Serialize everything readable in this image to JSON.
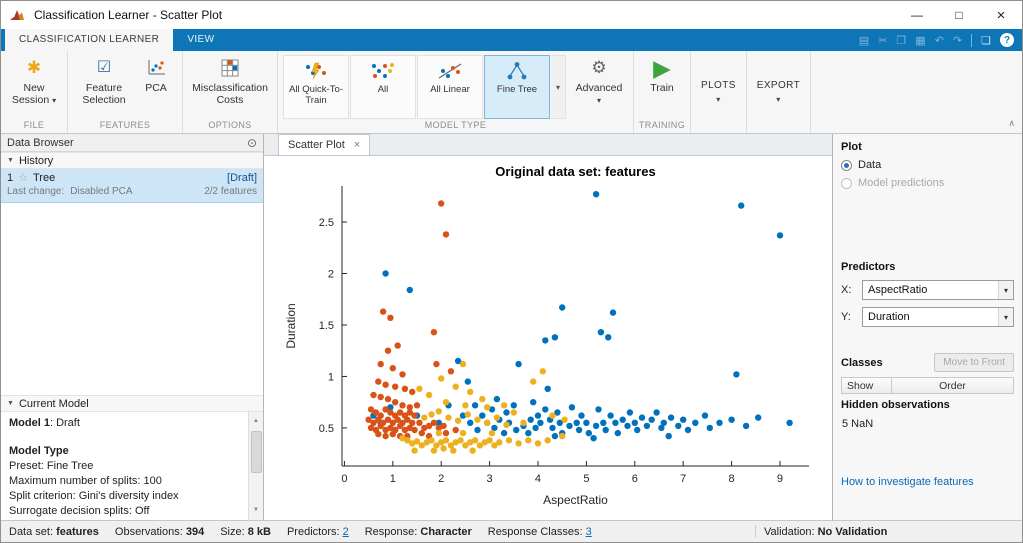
{
  "window": {
    "title": "Classification Learner - Scatter Plot"
  },
  "icons": {
    "save": "▤",
    "cut": "✂",
    "copy": "❐",
    "paste": "▦",
    "undo": "↶",
    "redo": "↷",
    "dock": "❏",
    "help": "?",
    "new_session": "✱",
    "feature_list": "☑",
    "gear": "⚙",
    "play": "▶",
    "caret": "▾",
    "collapse": "▼",
    "panel_menu": "⊙",
    "star": "☆",
    "close": "×",
    "min": "—",
    "max": "□",
    "ribbon_collapse": "∧",
    "scroll_up": "▲",
    "scroll_down": "▼"
  },
  "ribbon": {
    "tabs": [
      "CLASSIFICATION LEARNER",
      "VIEW"
    ],
    "file": {
      "label": "FILE",
      "new_session": "New Session"
    },
    "features": {
      "label": "FEATURES",
      "feature_selection": "Feature Selection",
      "pca": "PCA"
    },
    "options": {
      "label": "OPTIONS",
      "misclassification_costs": "Misclassification Costs"
    },
    "model_type": {
      "label": "MODEL TYPE",
      "gallery": [
        "All Quick-To-Train",
        "All",
        "All Linear",
        "Fine Tree"
      ],
      "selected": "Fine Tree",
      "advanced": "Advanced"
    },
    "training": {
      "label": "TRAINING",
      "train": "Train"
    },
    "plots_label": "PLOTS",
    "export_label": "EXPORT"
  },
  "data_browser": {
    "title": "Data Browser",
    "history": {
      "header": "History",
      "item": {
        "index": "1",
        "name": "Tree",
        "status": "[Draft]",
        "last_change_label": "Last change:",
        "last_change_value": "Disabled PCA",
        "features": "2/2 features"
      }
    },
    "current_model": {
      "header": "Current Model",
      "model_label": "Model 1",
      "model_status": ": Draft",
      "type_header": "Model Type",
      "preset": "Preset: Fine Tree",
      "max_splits": "Maximum number of splits: 100",
      "split_criterion": "Split criterion: Gini's diversity index",
      "surrogate": "Surrogate decision splits: Off"
    }
  },
  "document": {
    "tab": "Scatter Plot"
  },
  "right_panel": {
    "plot": {
      "header": "Plot",
      "data_option": "Data",
      "predictions_option": "Model predictions",
      "selected": "Data"
    },
    "predictors": {
      "header": "Predictors",
      "x_label": "X:",
      "x_value": "AspectRatio",
      "y_label": "Y:",
      "y_value": "Duration"
    },
    "classes": {
      "header": "Classes",
      "move_to_front": "Move to Front",
      "show_col": "Show",
      "order_col": "Order"
    },
    "hidden": {
      "header": "Hidden observations",
      "value": "5 NaN"
    },
    "link": "How to investigate features"
  },
  "status_bar": {
    "items": [
      {
        "label": "Data set:",
        "value": "features",
        "link": false
      },
      {
        "label": "Observations:",
        "value": "394",
        "link": false
      },
      {
        "label": "Size:",
        "value": "8 kB",
        "link": false
      },
      {
        "label": "Predictors:",
        "value": "2",
        "link": true
      },
      {
        "label": "Response:",
        "value": "Character",
        "link": false
      },
      {
        "label": "Response Classes:",
        "value": "3",
        "link": true
      }
    ],
    "validation_label": "Validation: ",
    "validation_value": "No Validation"
  },
  "chart_data": {
    "type": "scatter",
    "title": "Original data set: features",
    "xlabel": "AspectRatio",
    "ylabel": "Duration",
    "xlim": [
      -0.05,
      9.6
    ],
    "ylim": [
      0.13,
      2.85
    ],
    "xticks": [
      0,
      1,
      2,
      3,
      4,
      5,
      6,
      7,
      8,
      9
    ],
    "yticks": [
      0.5,
      1,
      1.5,
      2,
      2.5
    ],
    "grid": false,
    "legend": "none",
    "series": [
      {
        "name": "blue",
        "color": "#0072BD",
        "points": [
          [
            5.2,
            2.77
          ],
          [
            8.2,
            2.66
          ],
          [
            9.0,
            2.37
          ],
          [
            0.85,
            2.0
          ],
          [
            1.35,
            1.84
          ],
          [
            4.5,
            1.67
          ],
          [
            5.55,
            1.62
          ],
          [
            5.3,
            1.43
          ],
          [
            4.35,
            1.38
          ],
          [
            5.45,
            1.38
          ],
          [
            4.15,
            1.35
          ],
          [
            3.6,
            1.12
          ],
          [
            2.35,
            1.15
          ],
          [
            8.1,
            1.02
          ],
          [
            2.55,
            0.95
          ],
          [
            4.2,
            0.88
          ],
          [
            2.7,
            0.72
          ],
          [
            3.15,
            0.78
          ],
          [
            3.9,
            0.75
          ],
          [
            4.7,
            0.7
          ],
          [
            5.25,
            0.68
          ],
          [
            4.15,
            0.68
          ],
          [
            3.35,
            0.65
          ],
          [
            4.4,
            0.65
          ],
          [
            5.9,
            0.65
          ],
          [
            6.45,
            0.65
          ],
          [
            2.45,
            0.62
          ],
          [
            2.85,
            0.62
          ],
          [
            4.0,
            0.62
          ],
          [
            4.9,
            0.62
          ],
          [
            5.5,
            0.62
          ],
          [
            7.45,
            0.62
          ],
          [
            0.6,
            0.62
          ],
          [
            3.2,
            0.58
          ],
          [
            3.85,
            0.58
          ],
          [
            4.25,
            0.58
          ],
          [
            5.75,
            0.58
          ],
          [
            6.35,
            0.58
          ],
          [
            8.0,
            0.58
          ],
          [
            2.6,
            0.55
          ],
          [
            2.95,
            0.55
          ],
          [
            3.4,
            0.55
          ],
          [
            4.05,
            0.55
          ],
          [
            4.45,
            0.55
          ],
          [
            4.8,
            0.55
          ],
          [
            5.0,
            0.55
          ],
          [
            5.35,
            0.55
          ],
          [
            5.6,
            0.55
          ],
          [
            6.0,
            0.55
          ],
          [
            6.6,
            0.55
          ],
          [
            7.25,
            0.55
          ],
          [
            7.75,
            0.55
          ],
          [
            9.2,
            0.55
          ],
          [
            0.75,
            0.55
          ],
          [
            1.95,
            0.55
          ],
          [
            3.7,
            0.52
          ],
          [
            4.65,
            0.52
          ],
          [
            5.2,
            0.52
          ],
          [
            5.85,
            0.52
          ],
          [
            6.25,
            0.52
          ],
          [
            6.9,
            0.52
          ],
          [
            8.3,
            0.52
          ],
          [
            3.1,
            0.5
          ],
          [
            3.95,
            0.5
          ],
          [
            4.3,
            0.5
          ],
          [
            6.55,
            0.5
          ],
          [
            7.55,
            0.5
          ],
          [
            2.75,
            0.48
          ],
          [
            3.55,
            0.48
          ],
          [
            4.85,
            0.48
          ],
          [
            5.4,
            0.48
          ],
          [
            6.05,
            0.48
          ],
          [
            7.1,
            0.48
          ],
          [
            1.05,
            0.48
          ],
          [
            3.3,
            0.45
          ],
          [
            3.8,
            0.45
          ],
          [
            4.5,
            0.45
          ],
          [
            5.05,
            0.45
          ],
          [
            5.65,
            0.45
          ],
          [
            4.35,
            0.42
          ],
          [
            6.7,
            0.42
          ],
          [
            5.15,
            0.4
          ],
          [
            1.5,
            0.62
          ],
          [
            2.15,
            0.72
          ],
          [
            0.95,
            0.7
          ],
          [
            8.55,
            0.6
          ],
          [
            6.15,
            0.6
          ],
          [
            7.0,
            0.58
          ],
          [
            6.75,
            0.6
          ],
          [
            3.5,
            0.72
          ],
          [
            3.05,
            0.68
          ]
        ]
      },
      {
        "name": "orange",
        "color": "#D95319",
        "points": [
          [
            2.0,
            2.68
          ],
          [
            2.1,
            2.38
          ],
          [
            0.8,
            1.63
          ],
          [
            0.95,
            1.57
          ],
          [
            1.85,
            1.43
          ],
          [
            1.1,
            1.3
          ],
          [
            0.9,
            1.25
          ],
          [
            0.75,
            1.12
          ],
          [
            1.9,
            1.12
          ],
          [
            1.0,
            1.08
          ],
          [
            2.2,
            1.05
          ],
          [
            1.2,
            1.02
          ],
          [
            0.7,
            0.95
          ],
          [
            0.85,
            0.92
          ],
          [
            1.05,
            0.9
          ],
          [
            1.25,
            0.88
          ],
          [
            1.4,
            0.85
          ],
          [
            0.6,
            0.82
          ],
          [
            0.75,
            0.8
          ],
          [
            0.9,
            0.78
          ],
          [
            1.05,
            0.75
          ],
          [
            1.2,
            0.72
          ],
          [
            1.5,
            0.72
          ],
          [
            1.35,
            0.7
          ],
          [
            0.55,
            0.68
          ],
          [
            0.65,
            0.65
          ],
          [
            0.85,
            0.68
          ],
          [
            0.95,
            0.65
          ],
          [
            1.15,
            0.65
          ],
          [
            1.35,
            0.65
          ],
          [
            0.75,
            0.62
          ],
          [
            1.05,
            0.62
          ],
          [
            1.25,
            0.62
          ],
          [
            1.45,
            0.62
          ],
          [
            0.5,
            0.58
          ],
          [
            0.7,
            0.58
          ],
          [
            0.9,
            0.58
          ],
          [
            1.1,
            0.58
          ],
          [
            1.3,
            0.58
          ],
          [
            0.6,
            0.55
          ],
          [
            0.8,
            0.55
          ],
          [
            1.0,
            0.55
          ],
          [
            1.2,
            0.55
          ],
          [
            1.4,
            0.55
          ],
          [
            1.55,
            0.55
          ],
          [
            1.85,
            0.55
          ],
          [
            0.55,
            0.5
          ],
          [
            0.95,
            0.5
          ],
          [
            1.35,
            0.5
          ],
          [
            1.65,
            0.5
          ],
          [
            1.95,
            0.5
          ],
          [
            0.65,
            0.48
          ],
          [
            0.85,
            0.48
          ],
          [
            1.05,
            0.48
          ],
          [
            1.25,
            0.48
          ],
          [
            1.45,
            0.48
          ],
          [
            0.75,
            0.52
          ],
          [
            1.15,
            0.52
          ],
          [
            1.75,
            0.52
          ],
          [
            2.05,
            0.52
          ],
          [
            0.7,
            0.44
          ],
          [
            0.85,
            0.42
          ],
          [
            1.0,
            0.44
          ],
          [
            1.15,
            0.42
          ],
          [
            1.3,
            0.42
          ],
          [
            1.6,
            0.45
          ],
          [
            1.75,
            0.42
          ],
          [
            2.1,
            0.45
          ],
          [
            2.3,
            0.48
          ]
        ]
      },
      {
        "name": "yellow",
        "color": "#EDB120",
        "points": [
          [
            2.45,
            1.12
          ],
          [
            4.1,
            1.05
          ],
          [
            2.0,
            0.98
          ],
          [
            3.9,
            0.95
          ],
          [
            2.3,
            0.9
          ],
          [
            1.55,
            0.88
          ],
          [
            2.6,
            0.85
          ],
          [
            1.75,
            0.82
          ],
          [
            2.85,
            0.78
          ],
          [
            2.1,
            0.75
          ],
          [
            2.5,
            0.72
          ],
          [
            3.3,
            0.72
          ],
          [
            2.95,
            0.7
          ],
          [
            1.95,
            0.66
          ],
          [
            3.5,
            0.65
          ],
          [
            1.8,
            0.63
          ],
          [
            2.55,
            0.63
          ],
          [
            4.3,
            0.62
          ],
          [
            1.65,
            0.6
          ],
          [
            2.15,
            0.6
          ],
          [
            3.15,
            0.6
          ],
          [
            2.75,
            0.58
          ],
          [
            4.55,
            0.58
          ],
          [
            2.35,
            0.57
          ],
          [
            2.95,
            0.55
          ],
          [
            3.7,
            0.55
          ],
          [
            3.35,
            0.53
          ],
          [
            1.95,
            0.45
          ],
          [
            2.45,
            0.45
          ],
          [
            3.05,
            0.45
          ],
          [
            4.5,
            0.42
          ],
          [
            1.2,
            0.4
          ],
          [
            1.3,
            0.38
          ],
          [
            1.8,
            0.38
          ],
          [
            2.1,
            0.38
          ],
          [
            2.4,
            0.38
          ],
          [
            2.7,
            0.38
          ],
          [
            3.0,
            0.38
          ],
          [
            3.4,
            0.38
          ],
          [
            3.8,
            0.38
          ],
          [
            4.2,
            0.38
          ],
          [
            1.5,
            0.37
          ],
          [
            1.7,
            0.36
          ],
          [
            2.0,
            0.36
          ],
          [
            2.3,
            0.36
          ],
          [
            2.6,
            0.36
          ],
          [
            2.9,
            0.36
          ],
          [
            1.4,
            0.35
          ],
          [
            1.9,
            0.33
          ],
          [
            2.2,
            0.33
          ],
          [
            2.5,
            0.33
          ],
          [
            2.8,
            0.33
          ],
          [
            3.1,
            0.33
          ],
          [
            3.6,
            0.35
          ],
          [
            4.0,
            0.35
          ],
          [
            1.6,
            0.33
          ],
          [
            3.2,
            0.36
          ],
          [
            1.45,
            0.28
          ],
          [
            1.85,
            0.28
          ],
          [
            2.25,
            0.28
          ],
          [
            2.65,
            0.28
          ],
          [
            2.05,
            0.3
          ]
        ]
      }
    ]
  }
}
